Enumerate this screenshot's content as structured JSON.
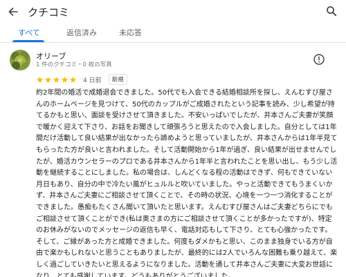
{
  "header": {
    "title": "クチコミ",
    "back_icon": "arrow-left-icon",
    "search_icon": "search-icon"
  },
  "tabs": [
    {
      "label": "すべて",
      "active": true
    },
    {
      "label": "返信済み",
      "active": false
    },
    {
      "label": "未応答",
      "active": false
    }
  ],
  "review": {
    "author": "オリーブ",
    "meta": "1 件のクチコミ・0 枚の写真",
    "rating": 5,
    "date": "4 日前",
    "badge": "新規",
    "info_icon": "info-icon",
    "text": "約2年間の婚活で成婚退会できました。50代でも入会できる結婚相談所を探し、えんむすび屋さんのホームページを見つけて、50代のカップルがご成婚されたという記事を読み、少し希望が持てるかもと思い、面談を受けさせて頂きました。不安いっぱいでしたが、井本さんご夫妻が笑顔で暖かく迎えて下さり、お話をお聞きして頑張ろうと思えたので入会しました。自分としては1年間だけ活動して良い結果が出なかったら諦めようと思っていましたが、井本さんからは1年半見てもらったた方が良いと言われました。そして活動開始から1年が過ぎ、良い結果が出せませんでしたが、婚活カウンセラーのプロである井本さんから1年半と言われたことを思い出し、もう少し活動を継続することにしました。私の場合は、しんどくなる程の活動はできず、何もできていない月日もあり、自分の中で冷たい風がヒュルルと吹いていました。やっと活動できてもうまくいかず、井本さんご夫妻にご相談させて頂くことで、その時の状況、心境を一つ一つ消化することができました。愚痴もたくさん聞いて頂いたと思います。えんむすび屋さんはご夫妻どちらにでもご相談させて頂くことができ(私は奥さまの方にご相談させて頂くことが多かったですが)、特定のお休みがないのでメッセージの返信も早く、電話対応もして下さり、とても心強かったです。そして、ご縁があった方と成婚できました。何度もダメかもと思い、このまま独身でいる方が自由で楽かもしれないと思うこともありましたが、最終的には2人でいろんな困難も乗り越えて、楽しく過ごしていきたいと思えるようになりました。活動を通して井本さんご夫妻に大変お世話になり、とても感謝しています。どうもありがとうございました。"
  },
  "colors": {
    "accent": "#1a73e8",
    "star": "#fbbc04",
    "text": "#202124",
    "muted": "#70757a"
  }
}
